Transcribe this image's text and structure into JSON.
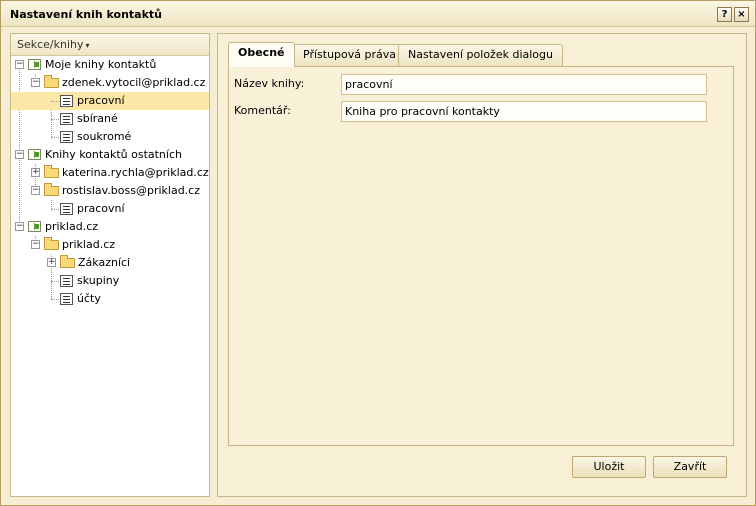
{
  "window": {
    "title": "Nastavení knih kontaktů",
    "help_glyph": "?",
    "close_glyph": "×"
  },
  "sidebar": {
    "header": "Sekce/knihy",
    "caret": "▾"
  },
  "tree": [
    {
      "label": "Moje knihy kontaktů",
      "expander": "−"
    },
    {
      "label": "zdenek.vytocil@priklad.cz",
      "expander": "−"
    },
    {
      "label": "pracovní",
      "selected": true
    },
    {
      "label": "sbírané"
    },
    {
      "label": "soukromé"
    },
    {
      "label": "Knihy kontaktů ostatních",
      "expander": "−"
    },
    {
      "label": "katerina.rychla@priklad.cz",
      "expander": "+"
    },
    {
      "label": "rostislav.boss@priklad.cz",
      "expander": "−"
    },
    {
      "label": "pracovní"
    },
    {
      "label": "priklad.cz",
      "expander": "−"
    },
    {
      "label": "priklad.cz",
      "expander": "−"
    },
    {
      "label": "Zákazníci",
      "expander": "+"
    },
    {
      "label": "skupiny"
    },
    {
      "label": "účty"
    }
  ],
  "tabs": [
    "Obecné",
    "Přístupová práva",
    "Nastavení položek dialogu"
  ],
  "form": {
    "name_label": "Název knihy:",
    "name_value": "pracovní",
    "comment_label": "Komentář:",
    "comment_value": "Kniha pro pracovní kontakty"
  },
  "buttons": {
    "save": "Uložit",
    "close": "Zavřít"
  }
}
